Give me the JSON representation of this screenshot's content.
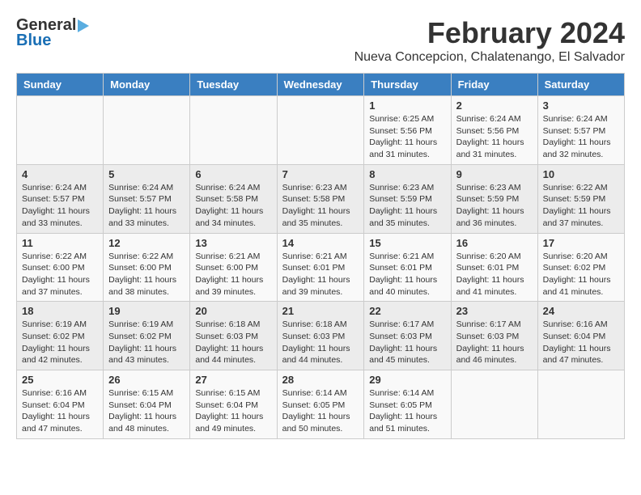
{
  "header": {
    "logo_general": "General",
    "logo_blue": "Blue",
    "title": "February 2024",
    "subtitle": "Nueva Concepcion, Chalatenango, El Salvador"
  },
  "calendar": {
    "days_of_week": [
      "Sunday",
      "Monday",
      "Tuesday",
      "Wednesday",
      "Thursday",
      "Friday",
      "Saturday"
    ],
    "weeks": [
      [
        {
          "day": "",
          "info": ""
        },
        {
          "day": "",
          "info": ""
        },
        {
          "day": "",
          "info": ""
        },
        {
          "day": "",
          "info": ""
        },
        {
          "day": "1",
          "info": "Sunrise: 6:25 AM\nSunset: 5:56 PM\nDaylight: 11 hours\nand 31 minutes."
        },
        {
          "day": "2",
          "info": "Sunrise: 6:24 AM\nSunset: 5:56 PM\nDaylight: 11 hours\nand 31 minutes."
        },
        {
          "day": "3",
          "info": "Sunrise: 6:24 AM\nSunset: 5:57 PM\nDaylight: 11 hours\nand 32 minutes."
        }
      ],
      [
        {
          "day": "4",
          "info": "Sunrise: 6:24 AM\nSunset: 5:57 PM\nDaylight: 11 hours\nand 33 minutes."
        },
        {
          "day": "5",
          "info": "Sunrise: 6:24 AM\nSunset: 5:57 PM\nDaylight: 11 hours\nand 33 minutes."
        },
        {
          "day": "6",
          "info": "Sunrise: 6:24 AM\nSunset: 5:58 PM\nDaylight: 11 hours\nand 34 minutes."
        },
        {
          "day": "7",
          "info": "Sunrise: 6:23 AM\nSunset: 5:58 PM\nDaylight: 11 hours\nand 35 minutes."
        },
        {
          "day": "8",
          "info": "Sunrise: 6:23 AM\nSunset: 5:59 PM\nDaylight: 11 hours\nand 35 minutes."
        },
        {
          "day": "9",
          "info": "Sunrise: 6:23 AM\nSunset: 5:59 PM\nDaylight: 11 hours\nand 36 minutes."
        },
        {
          "day": "10",
          "info": "Sunrise: 6:22 AM\nSunset: 5:59 PM\nDaylight: 11 hours\nand 37 minutes."
        }
      ],
      [
        {
          "day": "11",
          "info": "Sunrise: 6:22 AM\nSunset: 6:00 PM\nDaylight: 11 hours\nand 37 minutes."
        },
        {
          "day": "12",
          "info": "Sunrise: 6:22 AM\nSunset: 6:00 PM\nDaylight: 11 hours\nand 38 minutes."
        },
        {
          "day": "13",
          "info": "Sunrise: 6:21 AM\nSunset: 6:00 PM\nDaylight: 11 hours\nand 39 minutes."
        },
        {
          "day": "14",
          "info": "Sunrise: 6:21 AM\nSunset: 6:01 PM\nDaylight: 11 hours\nand 39 minutes."
        },
        {
          "day": "15",
          "info": "Sunrise: 6:21 AM\nSunset: 6:01 PM\nDaylight: 11 hours\nand 40 minutes."
        },
        {
          "day": "16",
          "info": "Sunrise: 6:20 AM\nSunset: 6:01 PM\nDaylight: 11 hours\nand 41 minutes."
        },
        {
          "day": "17",
          "info": "Sunrise: 6:20 AM\nSunset: 6:02 PM\nDaylight: 11 hours\nand 41 minutes."
        }
      ],
      [
        {
          "day": "18",
          "info": "Sunrise: 6:19 AM\nSunset: 6:02 PM\nDaylight: 11 hours\nand 42 minutes."
        },
        {
          "day": "19",
          "info": "Sunrise: 6:19 AM\nSunset: 6:02 PM\nDaylight: 11 hours\nand 43 minutes."
        },
        {
          "day": "20",
          "info": "Sunrise: 6:18 AM\nSunset: 6:03 PM\nDaylight: 11 hours\nand 44 minutes."
        },
        {
          "day": "21",
          "info": "Sunrise: 6:18 AM\nSunset: 6:03 PM\nDaylight: 11 hours\nand 44 minutes."
        },
        {
          "day": "22",
          "info": "Sunrise: 6:17 AM\nSunset: 6:03 PM\nDaylight: 11 hours\nand 45 minutes."
        },
        {
          "day": "23",
          "info": "Sunrise: 6:17 AM\nSunset: 6:03 PM\nDaylight: 11 hours\nand 46 minutes."
        },
        {
          "day": "24",
          "info": "Sunrise: 6:16 AM\nSunset: 6:04 PM\nDaylight: 11 hours\nand 47 minutes."
        }
      ],
      [
        {
          "day": "25",
          "info": "Sunrise: 6:16 AM\nSunset: 6:04 PM\nDaylight: 11 hours\nand 47 minutes."
        },
        {
          "day": "26",
          "info": "Sunrise: 6:15 AM\nSunset: 6:04 PM\nDaylight: 11 hours\nand 48 minutes."
        },
        {
          "day": "27",
          "info": "Sunrise: 6:15 AM\nSunset: 6:04 PM\nDaylight: 11 hours\nand 49 minutes."
        },
        {
          "day": "28",
          "info": "Sunrise: 6:14 AM\nSunset: 6:05 PM\nDaylight: 11 hours\nand 50 minutes."
        },
        {
          "day": "29",
          "info": "Sunrise: 6:14 AM\nSunset: 6:05 PM\nDaylight: 11 hours\nand 51 minutes."
        },
        {
          "day": "",
          "info": ""
        },
        {
          "day": "",
          "info": ""
        }
      ]
    ]
  }
}
